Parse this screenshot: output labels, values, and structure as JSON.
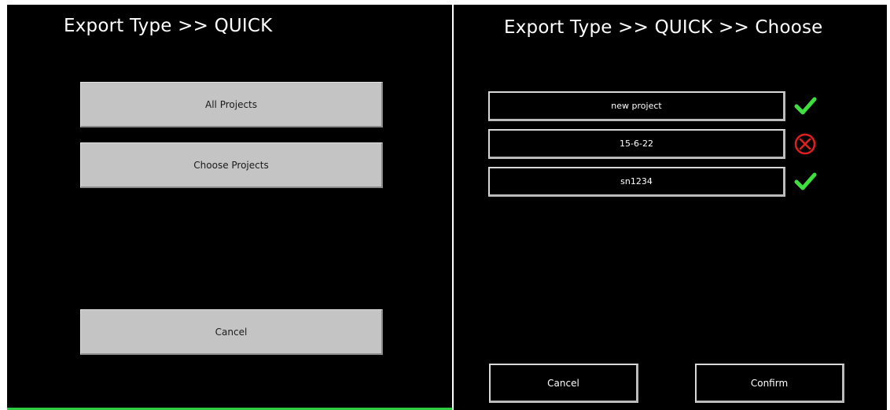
{
  "left_screen": {
    "title": "Export Type >> QUICK",
    "buttons": {
      "all_projects": "All Projects",
      "choose_projects": "Choose Projects",
      "cancel": "Cancel"
    },
    "accent_line_color": "#2ecc40"
  },
  "right_screen": {
    "title": "Export Type >> QUICK >> Choose",
    "projects": [
      {
        "name": "new project",
        "status": "selected",
        "status_icon": "checkmark-icon"
      },
      {
        "name": "15-6-22",
        "status": "not-selected",
        "status_icon": "cross-circle-icon"
      },
      {
        "name": "sn1234",
        "status": "selected",
        "status_icon": "checkmark-icon"
      }
    ],
    "buttons": {
      "cancel": "Cancel",
      "confirm": "Confirm"
    }
  },
  "colors": {
    "background": "#000000",
    "gray_button": "#c4c4c4",
    "check_green": "#3ee03e",
    "cross_red": "#e01e1e"
  }
}
